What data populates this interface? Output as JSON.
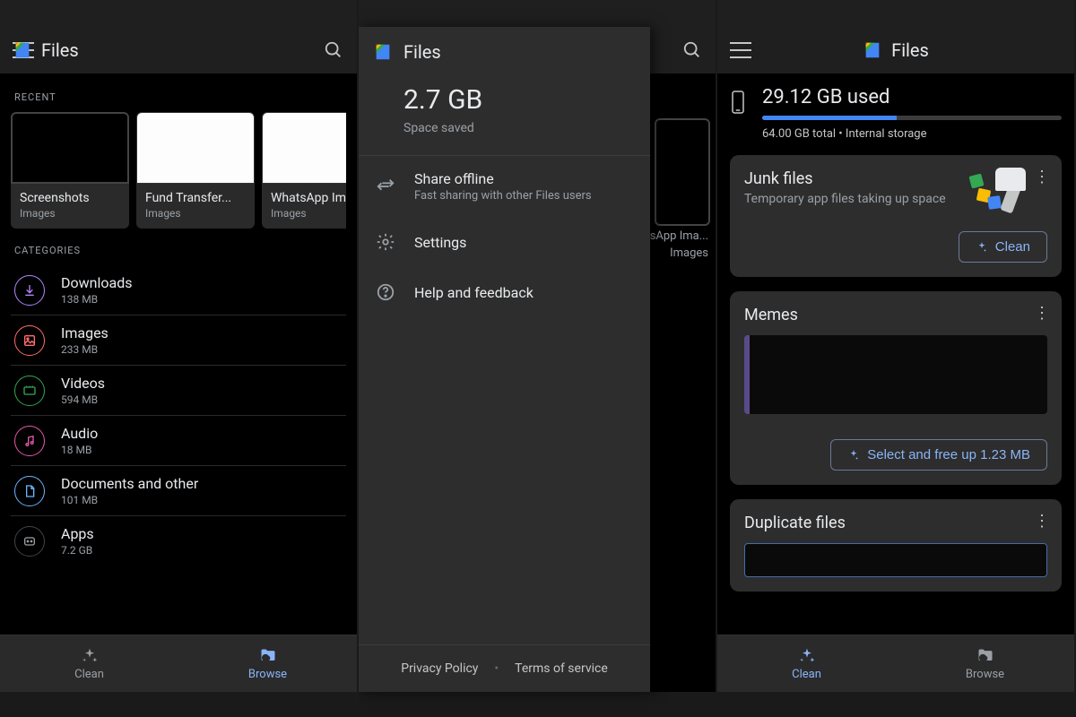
{
  "app": {
    "title": "Files"
  },
  "panel1": {
    "recent_label": "RECENT",
    "recent": [
      {
        "name": "Screenshots",
        "type": "Images"
      },
      {
        "name": "Fund Transfer...",
        "type": "Images"
      },
      {
        "name": "WhatsApp Ima...",
        "type": "Images"
      }
    ],
    "categories_label": "CATEGORIES",
    "categories": [
      {
        "name": "Downloads",
        "size": "138 MB"
      },
      {
        "name": "Images",
        "size": "233 MB"
      },
      {
        "name": "Videos",
        "size": "594 MB"
      },
      {
        "name": "Audio",
        "size": "18 MB"
      },
      {
        "name": "Documents and other",
        "size": "101 MB"
      },
      {
        "name": "Apps",
        "size": "7.2 GB"
      }
    ],
    "nav": {
      "clean": "Clean",
      "browse": "Browse"
    }
  },
  "panel2": {
    "bg_recent_label": "sApp Ima...",
    "bg_recent_type": "Images",
    "drawer": {
      "space_saved_value": "2.7 GB",
      "space_saved_label": "Space saved",
      "share_title": "Share offline",
      "share_sub": "Fast sharing with other Files users",
      "settings": "Settings",
      "help": "Help and feedback",
      "privacy": "Privacy Policy",
      "tos": "Terms of service"
    }
  },
  "panel3": {
    "storage": {
      "used": "29.12 GB used",
      "sub": "64.00 GB total • Internal storage",
      "percent": 45
    },
    "junk": {
      "title": "Junk files",
      "sub": "Temporary app files taking up space",
      "action": "Clean"
    },
    "memes": {
      "title": "Memes",
      "action": "Select and free up 1.23 MB"
    },
    "duplicates": {
      "title": "Duplicate files"
    },
    "nav": {
      "clean": "Clean",
      "browse": "Browse"
    }
  }
}
